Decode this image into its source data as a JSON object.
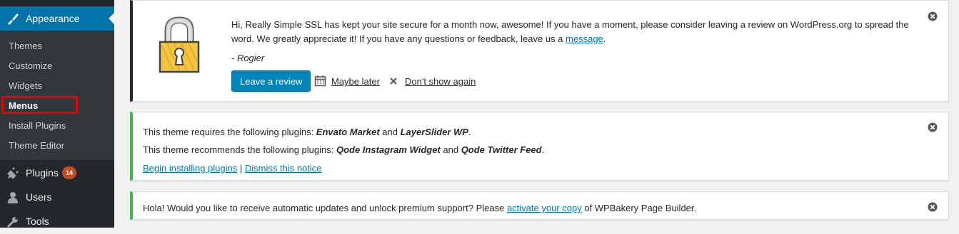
{
  "sidebar": {
    "appearance_label": "Appearance",
    "submenu": [
      "Themes",
      "Customize",
      "Widgets",
      "Menus",
      "Install Plugins",
      "Theme Editor"
    ],
    "current_item": "Menus",
    "plugins_label": "Plugins",
    "plugins_badge": "14",
    "users_label": "Users",
    "tools_label": "Tools"
  },
  "ssl_notice": {
    "line1": "Hi, Really Simple SSL has kept your site secure for a month now, awesome! If you have a moment, please consider leaving a review on WordPress.org to spread the",
    "line2_prefix": "word. We greatly appreciate it! If you have any questions or feedback, leave us a ",
    "line2_link": "message",
    "line2_suffix": ".",
    "signature": "- Rogier",
    "review_button": "Leave a review",
    "maybe_later": "Maybe later",
    "dont_show": "Don't show again"
  },
  "plugins_notice": {
    "req_prefix": "This theme requires the following plugins: ",
    "req_plugin1": "Envato Market",
    "and1": " and ",
    "req_plugin2": "LayerSlider WP",
    "req_suffix": ".",
    "rec_prefix": "This theme recommends the following plugins: ",
    "rec_plugin1": "Qode Instagram Widget",
    "and2": " and ",
    "rec_plugin2": "Qode Twitter Feed",
    "rec_suffix": ".",
    "install_link": "Begin installing plugins",
    "separator": " | ",
    "dismiss_link": "Dismiss this notice"
  },
  "wpb_notice": {
    "prefix": "Hola! Would you like to receive automatic updates and unlock premium support? Please ",
    "link": "activate your copy",
    "suffix": " of WPBakery Page Builder."
  },
  "colors": {
    "admin_blue": "#0073aa",
    "sidebar_dark": "#23282d",
    "success_green": "#46b450",
    "highlight_red": "#ee0000"
  }
}
